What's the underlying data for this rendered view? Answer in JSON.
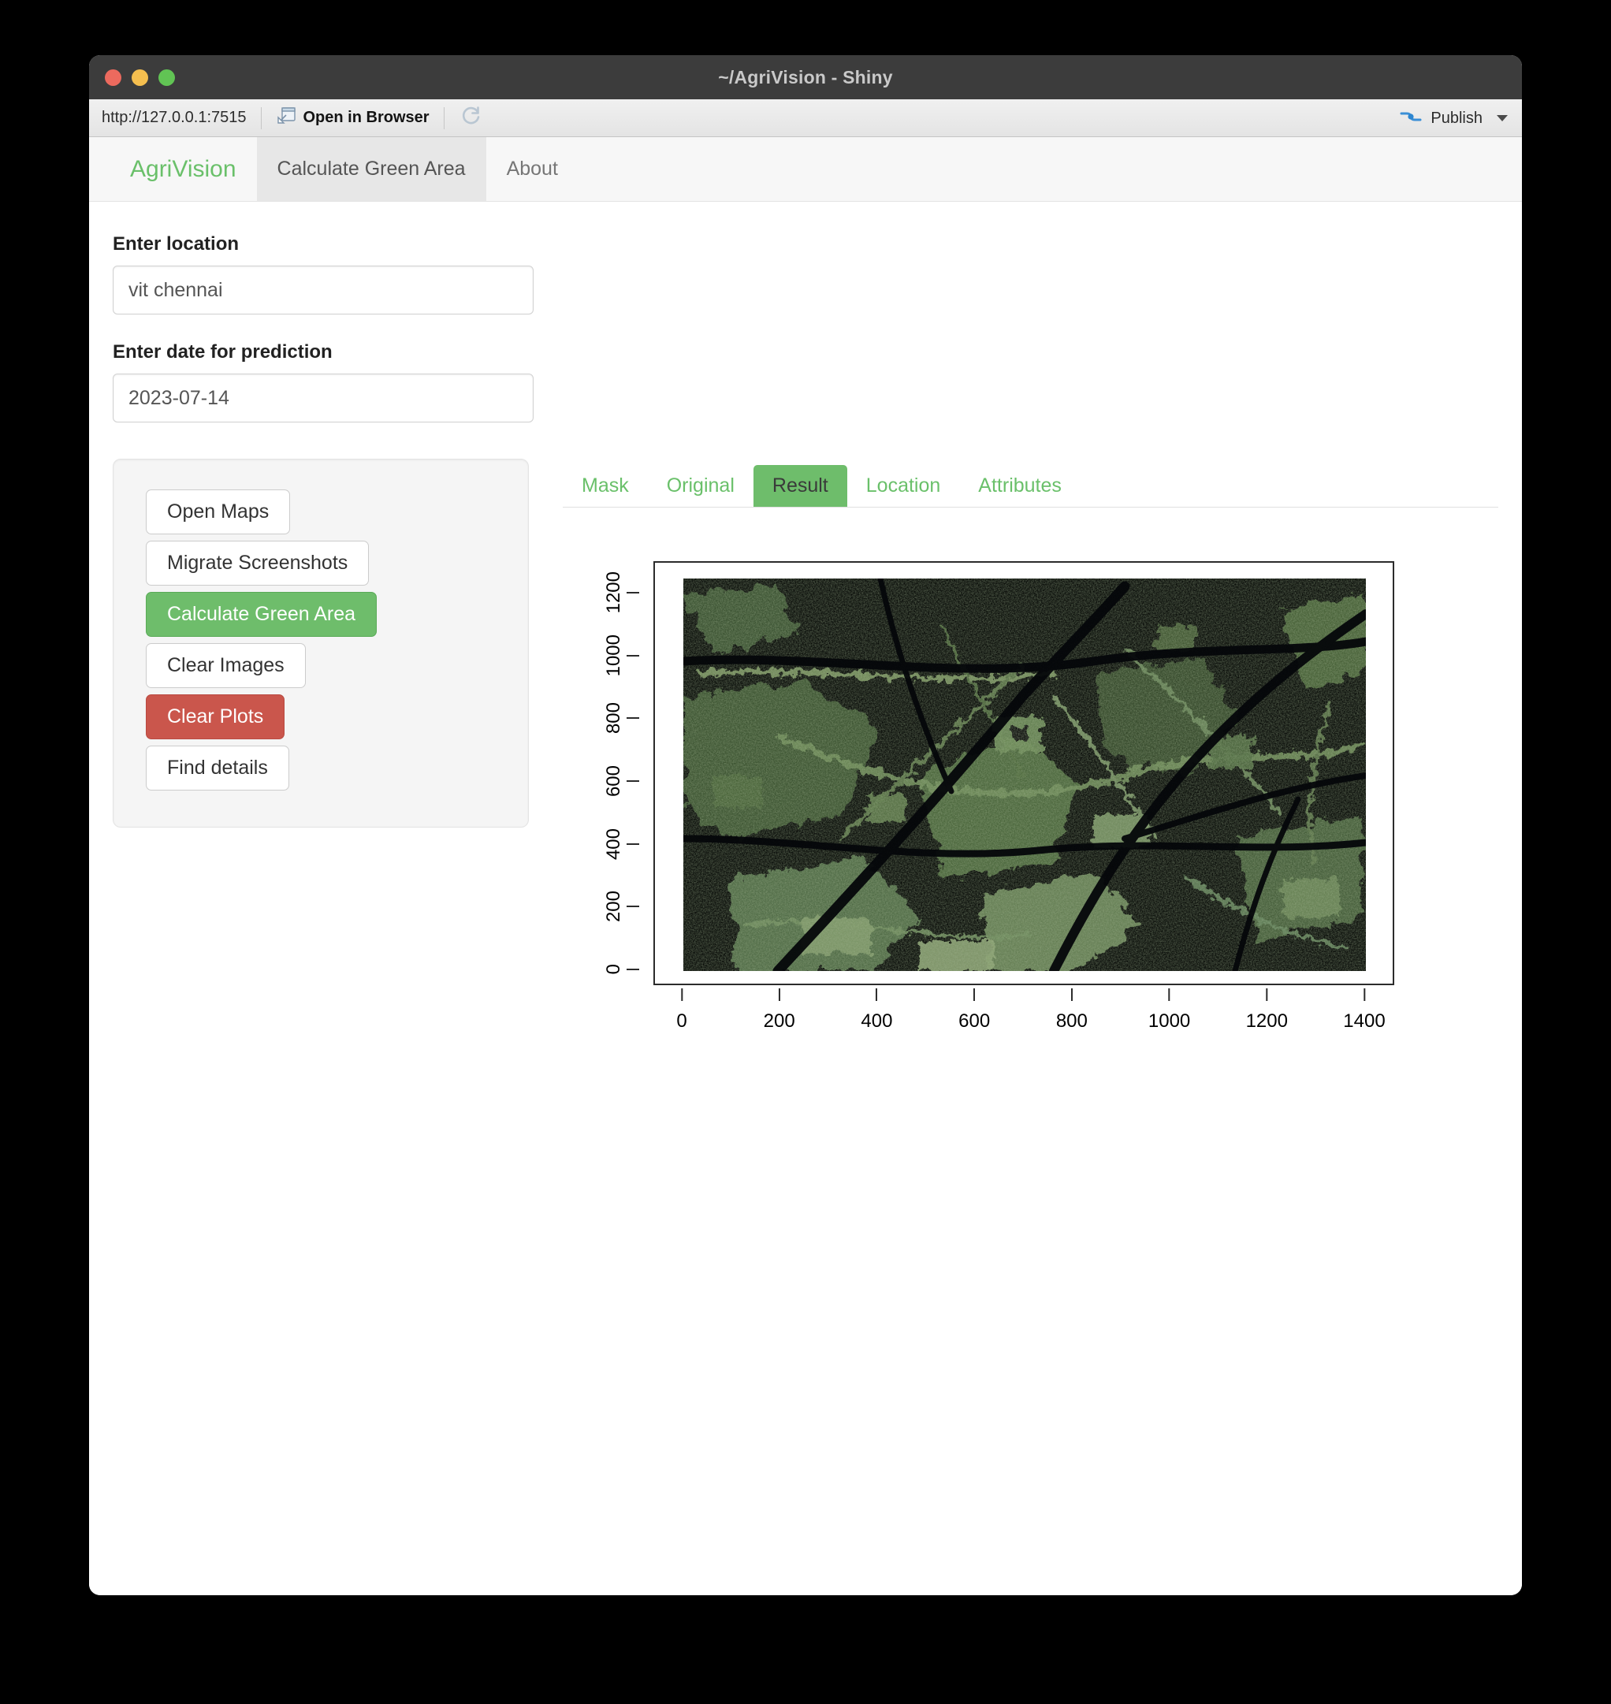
{
  "window": {
    "title": "~/AgriVision - Shiny",
    "traffic_lights": [
      "close",
      "minimize",
      "zoom"
    ]
  },
  "toolbar": {
    "url": "http://127.0.0.1:7515",
    "open_in_browser_label": "Open in Browser",
    "reload_icon": "reload-icon",
    "publish_label": "Publish",
    "publish_icon": "rsconnect-publish-icon"
  },
  "navbar": {
    "brand": "AgriVision",
    "brand_color": "#6ac06a",
    "tabs": [
      {
        "label": "Calculate Green Area",
        "active": true
      },
      {
        "label": "About",
        "active": false
      }
    ]
  },
  "form": {
    "location": {
      "label": "Enter location",
      "value": "vit chennai",
      "placeholder": "Enter location"
    },
    "date": {
      "label": "Enter date for prediction",
      "value": "2023-07-14",
      "placeholder": "yyyy-mm-dd"
    }
  },
  "actions": {
    "buttons": [
      {
        "label": "Open Maps",
        "style": "default"
      },
      {
        "label": "Migrate Screenshots",
        "style": "default"
      },
      {
        "label": "Calculate Green Area",
        "style": "primary"
      },
      {
        "label": "Clear Images",
        "style": "default"
      },
      {
        "label": "Clear Plots",
        "style": "danger"
      },
      {
        "label": "Find details",
        "style": "default"
      }
    ],
    "primary_color": "#6ebd6b",
    "danger_color": "#ca564c"
  },
  "result_tabs": [
    {
      "label": "Mask",
      "active": false
    },
    {
      "label": "Original",
      "active": false
    },
    {
      "label": "Result",
      "active": true
    },
    {
      "label": "Location",
      "active": false
    },
    {
      "label": "Attributes",
      "active": false
    }
  ],
  "chart_data": {
    "type": "heatmap",
    "title": "",
    "xlabel": "",
    "ylabel": "",
    "xlim": [
      0,
      1400
    ],
    "ylim": [
      0,
      1250
    ],
    "x_ticks": [
      0,
      200,
      400,
      600,
      800,
      1000,
      1200,
      1400
    ],
    "y_ticks": [
      0,
      200,
      400,
      600,
      800,
      1000,
      1200
    ],
    "grid": false,
    "legend": "none",
    "description": "Raster of a satellite image with a vegetation mask applied: green vegetation pixels retained over a black background",
    "background_color": "#050705",
    "vegetation_colors": [
      "#2f4226",
      "#4c6b3e",
      "#6f8c58",
      "#93a878",
      "#1d2a18"
    ]
  }
}
